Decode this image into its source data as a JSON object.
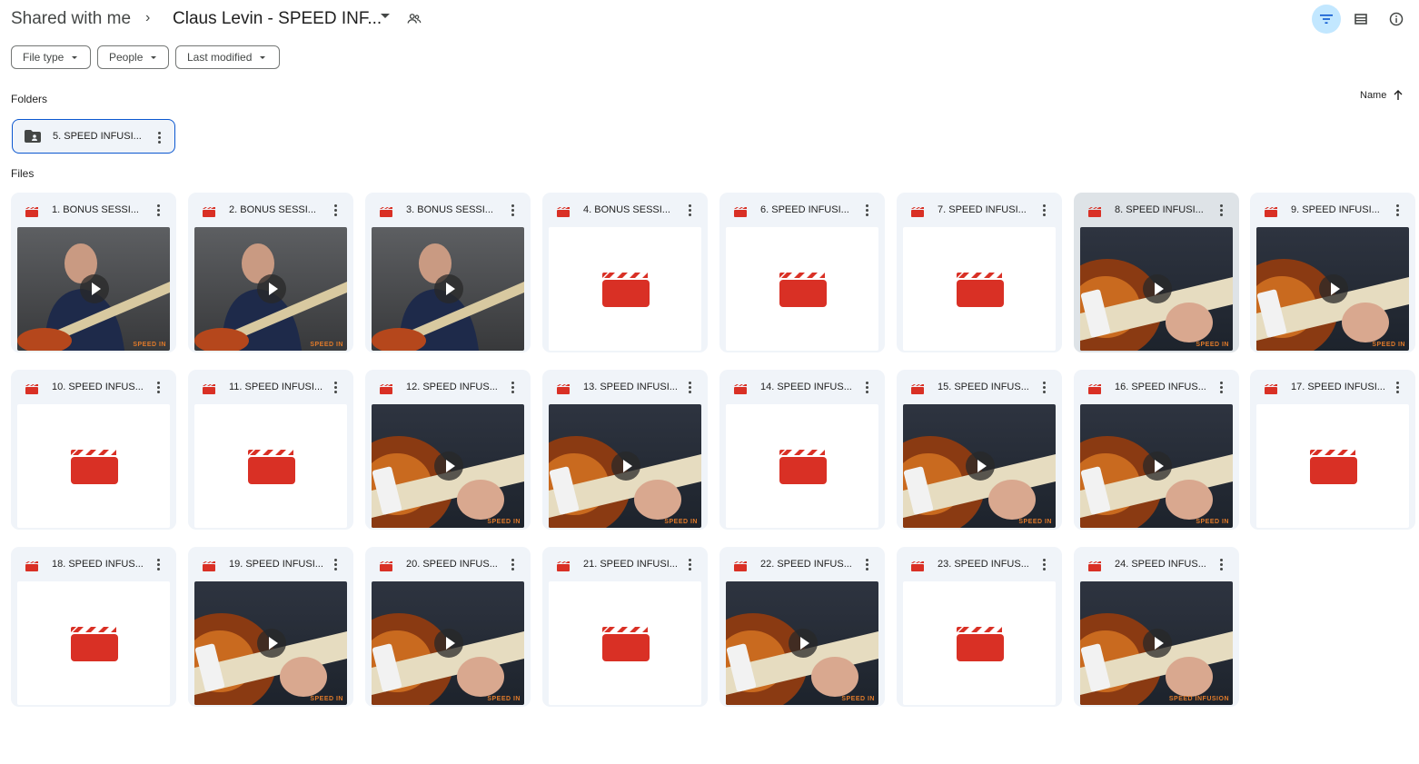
{
  "breadcrumb": {
    "root": "Shared with me",
    "separator": "›",
    "current": "Claus Levin - SPEED INF..."
  },
  "filters": {
    "file_type": "File type",
    "people": "People",
    "last_modified": "Last modified"
  },
  "sections": {
    "folders": "Folders",
    "files": "Files"
  },
  "sort": {
    "label": "Name",
    "icon": "arrow-up-icon"
  },
  "folders": [
    {
      "name": "5. SPEED INFUSI...",
      "icon": "shared-folder-icon"
    }
  ],
  "watermark": "SPEED IN",
  "watermark_full": "SPEED INFUSION",
  "colors": {
    "accent": "#0b57d0",
    "active_button": "#c2e7ff",
    "video_icon": "#d93025",
    "card_bg": "#f0f4f9"
  },
  "files": [
    {
      "name": "1. BONUS SESSI...",
      "thumb": "person"
    },
    {
      "name": "2. BONUS SESSI...",
      "thumb": "person"
    },
    {
      "name": "3. BONUS SESSI...",
      "thumb": "person"
    },
    {
      "name": "4. BONUS SESSI...",
      "thumb": "placeholder"
    },
    {
      "name": "6. SPEED INFUSI...",
      "thumb": "placeholder"
    },
    {
      "name": "7. SPEED INFUSI...",
      "thumb": "placeholder"
    },
    {
      "name": "8. SPEED INFUSI...",
      "thumb": "guitar"
    },
    {
      "name": "9. SPEED INFUSI...",
      "thumb": "guitar"
    },
    {
      "name": "10. SPEED INFUS...",
      "thumb": "placeholder"
    },
    {
      "name": "11. SPEED INFUSI...",
      "thumb": "placeholder"
    },
    {
      "name": "12. SPEED INFUS...",
      "thumb": "guitar"
    },
    {
      "name": "13. SPEED INFUSI...",
      "thumb": "guitar"
    },
    {
      "name": "14. SPEED INFUS...",
      "thumb": "placeholder"
    },
    {
      "name": "15. SPEED INFUS...",
      "thumb": "guitar"
    },
    {
      "name": "16. SPEED INFUS...",
      "thumb": "guitar"
    },
    {
      "name": "17. SPEED INFUSI...",
      "thumb": "placeholder"
    },
    {
      "name": "18. SPEED INFUS...",
      "thumb": "placeholder"
    },
    {
      "name": "19. SPEED INFUSI...",
      "thumb": "guitar"
    },
    {
      "name": "20. SPEED INFUS...",
      "thumb": "guitar"
    },
    {
      "name": "21. SPEED INFUSI...",
      "thumb": "placeholder"
    },
    {
      "name": "22. SPEED INFUS...",
      "thumb": "guitar"
    },
    {
      "name": "23. SPEED INFUS...",
      "thumb": "placeholder"
    },
    {
      "name": "24. SPEED INFUS...",
      "thumb": "guitar"
    }
  ]
}
